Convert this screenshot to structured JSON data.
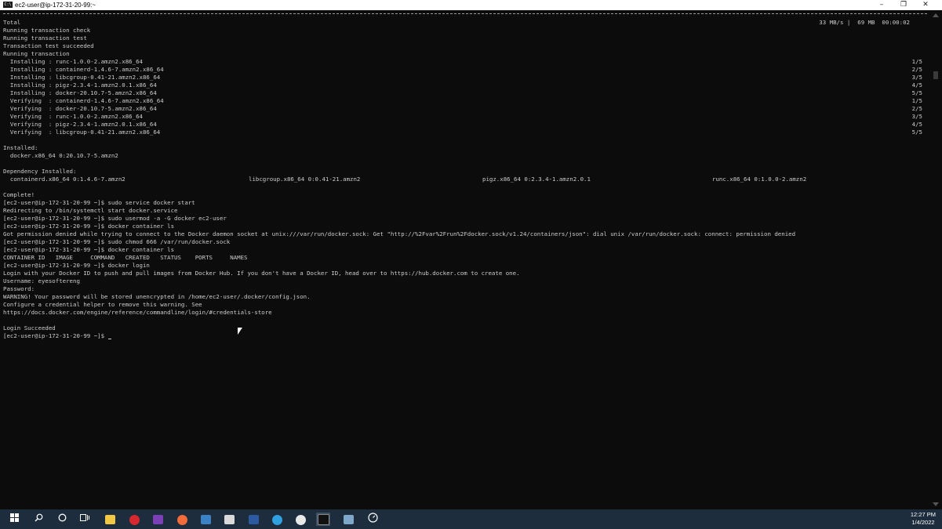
{
  "window": {
    "title": "ec2-user@ip-172-31-20-99:~",
    "icon_text": "C:\\",
    "minimize": "–",
    "maximize": "❐",
    "close": "✕"
  },
  "terminal": {
    "progress": "33 MB/s |  69 MB  00:00:02",
    "lines": [
      "Total",
      "Running transaction check",
      "Running transaction test",
      "Transaction test succeeded",
      "Running transaction",
      "  Installing : runc-1.0.0-2.amzn2.x86_64",
      "  Installing : containerd-1.4.6-7.amzn2.x86_64",
      "  Installing : libcgroup-0.41-21.amzn2.x86_64",
      "  Installing : pigz-2.3.4-1.amzn2.0.1.x86_64",
      "  Installing : docker-20.10.7-5.amzn2.x86_64",
      "  Verifying  : containerd-1.4.6-7.amzn2.x86_64",
      "  Verifying  : docker-20.10.7-5.amzn2.x86_64",
      "  Verifying  : runc-1.0.0-2.amzn2.x86_64",
      "  Verifying  : pigz-2.3.4-1.amzn2.0.1.x86_64",
      "  Verifying  : libcgroup-0.41-21.amzn2.x86_64",
      "",
      "Installed:",
      "  docker.x86_64 0:20.10.7-5.amzn2",
      "",
      "Dependency Installed:",
      "  containerd.x86_64 0:1.4.6-7.amzn2",
      "",
      "Complete!",
      "[ec2-user@ip-172-31-20-99 ~]$ sudo service docker start",
      "Redirecting to /bin/systemctl start docker.service",
      "[ec2-user@ip-172-31-20-99 ~]$ sudo usermod -a -G docker ec2-user",
      "[ec2-user@ip-172-31-20-99 ~]$ docker container ls",
      "Got permission denied while trying to connect to the Docker daemon socket at unix:///var/run/docker.sock: Get \"http://%2Fvar%2Frun%2Fdocker.sock/v1.24/containers/json\": dial unix /var/run/docker.sock: connect: permission denied",
      "[ec2-user@ip-172-31-20-99 ~]$ sudo chmod 666 /var/run/docker.sock",
      "[ec2-user@ip-172-31-20-99 ~]$ docker container ls",
      "CONTAINER ID   IMAGE     COMMAND   CREATED   STATUS    PORTS     NAMES",
      "[ec2-user@ip-172-31-20-99 ~]$ docker login",
      "Login with your Docker ID to push and pull images from Docker Hub. If you don't have a Docker ID, head over to https://hub.docker.com to create one.",
      "Username: eyesoftereng",
      "Password:",
      "WARNING! Your password will be stored unencrypted in /home/ec2-user/.docker/config.json.",
      "Configure a credential helper to remove this warning. See",
      "https://docs.docker.com/engine/reference/commandline/login/#credentials-store",
      "",
      "Login Succeeded",
      "[ec2-user@ip-172-31-20-99 ~]$ "
    ],
    "counts": [
      "1/5",
      "2/5",
      "3/5",
      "4/5",
      "5/5",
      "1/5",
      "2/5",
      "3/5",
      "4/5",
      "5/5"
    ],
    "deps": [
      "libcgroup.x86_64 0:0.41-21.amzn2",
      "pigz.x86_64 0:2.3.4-1.amzn2.0.1",
      "runc.x86_64 0:1.0.0-2.amzn2"
    ]
  },
  "taskbar": {
    "clock_time": "12:27 PM",
    "clock_date": "1/4/2022"
  }
}
